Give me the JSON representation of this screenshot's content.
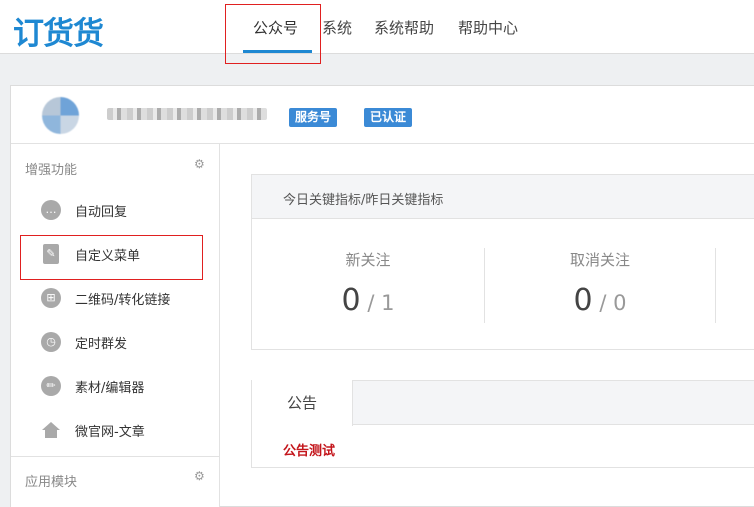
{
  "brand": {
    "logo_text": "订货货",
    "color": "#1e88d2"
  },
  "topnav": {
    "items": [
      "公众号",
      "系统",
      "系统帮助",
      "帮助中心"
    ],
    "active_index": 0
  },
  "account": {
    "type_badge": "服务号",
    "verify_badge": "已认证"
  },
  "sidebar": {
    "section1_title": "增强功能",
    "section2_title": "应用模块",
    "items": [
      {
        "label": "自动回复",
        "icon": "chat-bubble-icon"
      },
      {
        "label": "自定义菜单",
        "icon": "document-edit-icon"
      },
      {
        "label": "二维码/转化链接",
        "icon": "qr-link-icon"
      },
      {
        "label": "定时群发",
        "icon": "clock-icon"
      },
      {
        "label": "素材/编辑器",
        "icon": "pencil-icon"
      },
      {
        "label": "微官网-文章",
        "icon": "home-icon"
      }
    ]
  },
  "metrics": {
    "title": "今日关键指标/昨日关键指标",
    "stats": [
      {
        "label": "新关注",
        "today": "0",
        "yesterday": "1"
      },
      {
        "label": "取消关注",
        "today": "0",
        "yesterday": "0"
      }
    ]
  },
  "notice": {
    "tab_label": "公告",
    "link_text": "公告测试",
    "link_color": "#c4161c"
  },
  "highlight_color": "#e02020"
}
